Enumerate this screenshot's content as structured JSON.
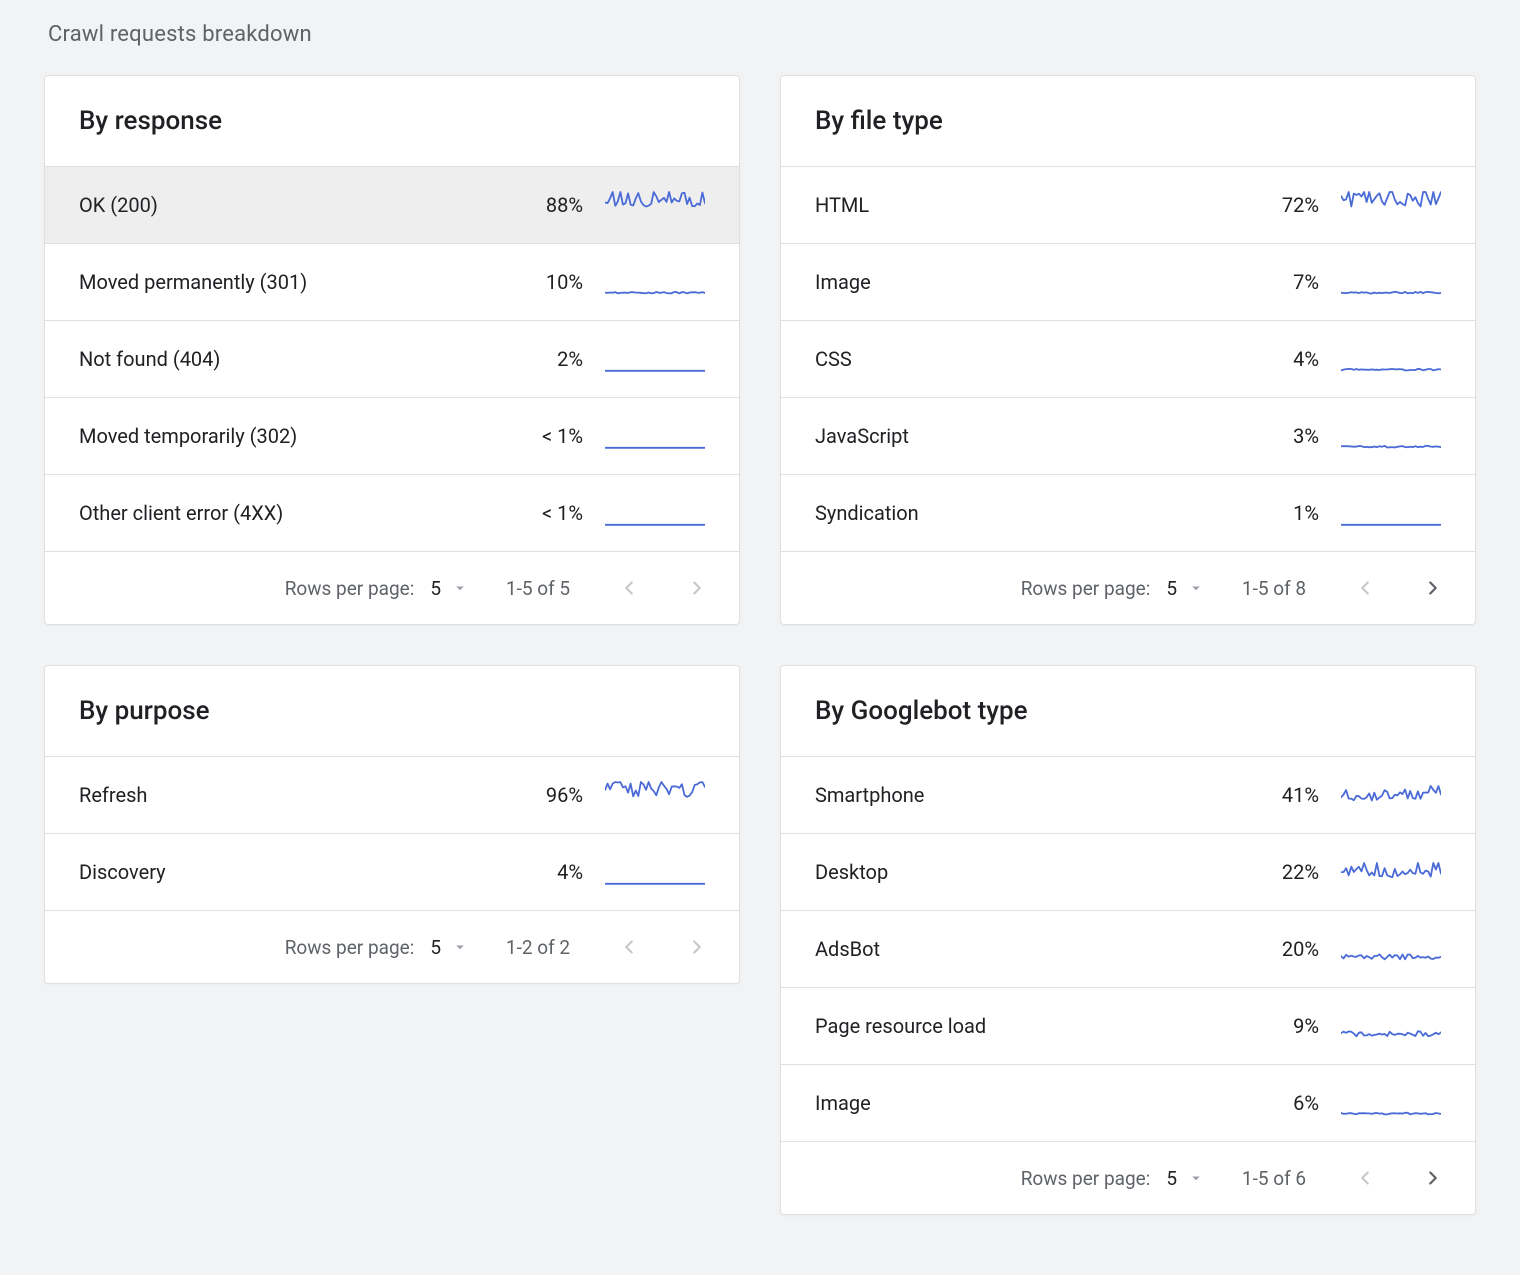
{
  "page_title": "Crawl requests breakdown",
  "footer_strings": {
    "rows_per_page": "Rows per page:"
  },
  "cards": {
    "by_response": {
      "title": "By response",
      "rows_per_page": "5",
      "range": "1-5 of 5",
      "prev_enabled": false,
      "next_enabled": false,
      "rows": [
        {
          "label": "OK (200)",
          "value": "88%",
          "spark": "high-jitter",
          "selected": true
        },
        {
          "label": "Moved permanently (301)",
          "value": "10%",
          "spark": "low-flat"
        },
        {
          "label": "Not found (404)",
          "value": "2%",
          "spark": "flat"
        },
        {
          "label": "Moved temporarily (302)",
          "value": "< 1%",
          "spark": "flat"
        },
        {
          "label": "Other client error (4XX)",
          "value": "< 1%",
          "spark": "flat"
        }
      ]
    },
    "by_file_type": {
      "title": "By file type",
      "rows_per_page": "5",
      "range": "1-5 of 8",
      "prev_enabled": false,
      "next_enabled": true,
      "rows": [
        {
          "label": "HTML",
          "value": "72%",
          "spark": "high-jitter"
        },
        {
          "label": "Image",
          "value": "7%",
          "spark": "low-flat"
        },
        {
          "label": "CSS",
          "value": "4%",
          "spark": "low-flat"
        },
        {
          "label": "JavaScript",
          "value": "3%",
          "spark": "low-flat"
        },
        {
          "label": "Syndication",
          "value": "1%",
          "spark": "flat"
        }
      ]
    },
    "by_purpose": {
      "title": "By purpose",
      "rows_per_page": "5",
      "range": "1-2 of 2",
      "prev_enabled": false,
      "next_enabled": false,
      "rows": [
        {
          "label": "Refresh",
          "value": "96%",
          "spark": "high-jitter"
        },
        {
          "label": "Discovery",
          "value": "4%",
          "spark": "flat"
        }
      ]
    },
    "by_googlebot_type": {
      "title": "By Googlebot type",
      "rows_per_page": "5",
      "range": "1-5 of 6",
      "prev_enabled": false,
      "next_enabled": true,
      "rows": [
        {
          "label": "Smartphone",
          "value": "41%",
          "spark": "med-jitter"
        },
        {
          "label": "Desktop",
          "value": "22%",
          "spark": "med-jitter"
        },
        {
          "label": "AdsBot",
          "value": "20%",
          "spark": "low-jitter"
        },
        {
          "label": "Page resource load",
          "value": "9%",
          "spark": "low-jitter"
        },
        {
          "label": "Image",
          "value": "6%",
          "spark": "low-flat"
        }
      ]
    }
  },
  "chart_data": [
    {
      "type": "table",
      "title": "By response",
      "categories": [
        "OK (200)",
        "Moved permanently (301)",
        "Not found (404)",
        "Moved temporarily (302)",
        "Other client error (4XX)"
      ],
      "values": [
        88,
        10,
        2,
        0.5,
        0.5
      ],
      "unit": "%"
    },
    {
      "type": "table",
      "title": "By file type",
      "categories": [
        "HTML",
        "Image",
        "CSS",
        "JavaScript",
        "Syndication"
      ],
      "values": [
        72,
        7,
        4,
        3,
        1
      ],
      "unit": "%",
      "note": "showing 5 of 8"
    },
    {
      "type": "table",
      "title": "By purpose",
      "categories": [
        "Refresh",
        "Discovery"
      ],
      "values": [
        96,
        4
      ],
      "unit": "%"
    },
    {
      "type": "table",
      "title": "By Googlebot type",
      "categories": [
        "Smartphone",
        "Desktop",
        "AdsBot",
        "Page resource load",
        "Image"
      ],
      "values": [
        41,
        22,
        20,
        9,
        6
      ],
      "unit": "%",
      "note": "showing 5 of 6"
    }
  ]
}
